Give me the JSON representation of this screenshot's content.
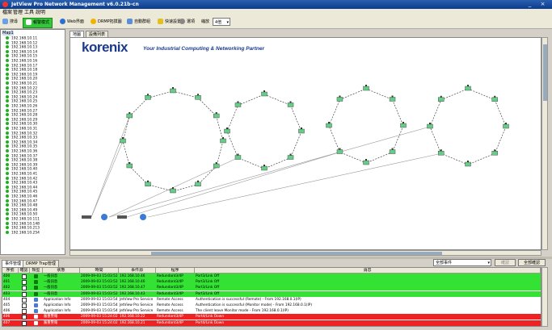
{
  "window": {
    "title": "JetView Pro Network Management v6.0.21b-cn",
    "controls": [
      "_",
      "×"
    ]
  },
  "menu": [
    "檔案",
    "管理",
    "工具",
    "說明"
  ],
  "toolbar": {
    "buttons": [
      "搜尋",
      "報警模式",
      "Web界面",
      "DRMP拓撲圖",
      "自動群組",
      "快速設置",
      "選項"
    ],
    "zoom_label": "縮放",
    "zoom_value": "4倍"
  },
  "tree": {
    "root": "Map1",
    "items": [
      "192.168.10.11",
      "192.168.10.12",
      "192.168.10.13",
      "192.168.10.14",
      "192.168.10.15",
      "192.168.10.16",
      "192.168.10.17",
      "192.168.10.18",
      "192.168.10.19",
      "192.168.10.20",
      "192.168.10.21",
      "192.168.10.22",
      "192.168.10.23",
      "192.168.10.24",
      "192.168.10.25",
      "192.168.10.26",
      "192.168.10.27",
      "192.168.10.28",
      "192.168.10.29",
      "192.168.10.30",
      "192.168.10.31",
      "192.168.10.32",
      "192.168.10.33",
      "192.168.10.34",
      "192.168.10.35",
      "192.168.10.36",
      "192.168.10.37",
      "192.168.10.38",
      "192.168.10.39",
      "192.168.10.40",
      "192.168.10.41",
      "192.168.10.42",
      "192.168.10.43",
      "192.168.10.44",
      "192.168.10.45",
      "192.168.10.46",
      "192.168.10.47",
      "192.168.10.48",
      "192.168.10.49",
      "192.168.10.50",
      "192.168.10.111",
      "192.168.10.148",
      "192.168.10.213",
      "192.168.10.254"
    ]
  },
  "map_tabs": [
    "地圖",
    "設備列表"
  ],
  "canvas": {
    "brand": "korenix",
    "tagline": "Your Industrial Computing & Networking Partner",
    "accent": "#1b3a8c"
  },
  "bottom_tabs": [
    "事件管理",
    "DRMP Trap管理"
  ],
  "filter": {
    "value": "全部事件",
    "buttons": [
      "確認",
      "全部確認"
    ]
  },
  "event_table": {
    "columns": [
      "序號",
      "確認",
      "類型",
      "狀態",
      "時間",
      "事件源",
      "程序",
      "消息"
    ],
    "rows": [
      {
        "color": "#33e233",
        "id": "400",
        "type": "一般訊息",
        "time": "2009-09-03 15:03:52",
        "source": "192.168.10.46",
        "program": "Redundant3/4P",
        "message": "Port3/Link Off"
      },
      {
        "color": "#33e233",
        "id": "401",
        "type": "一般訊息",
        "time": "2009-09-03 15:03:52",
        "source": "192.168.10.46",
        "program": "Redundant3/4P",
        "message": "Port3/Link Off"
      },
      {
        "color": "#33e233",
        "id": "402",
        "type": "一般訊息",
        "time": "2009-09-03 15:03:52",
        "source": "192.168.10.47",
        "program": "Redundant3/4P",
        "message": "Port3/Link Off"
      },
      {
        "color": "#33e233",
        "id": "403",
        "type": "一般訊息",
        "time": "2009-09-03 15:03:52",
        "source": "192.168.10.43",
        "program": "Redundant3/4P",
        "message": "Port3/Link Off"
      },
      {
        "color": "#ffffff",
        "id": "404",
        "type": "Application Info",
        "time": "2009-09-03 15:03:54",
        "source": "JetView Pro Service",
        "program": "Remote Access",
        "message": "Authentication is successful (Remote) - From 192.168.0.1(IP)"
      },
      {
        "color": "#ffffff",
        "id": "405",
        "type": "Application Info",
        "time": "2009-09-03 15:03:54",
        "source": "JetView Pro Service",
        "program": "Remote Access",
        "message": "Authentication is successful (Monitor mode) - From 192.168.0.1(IP)"
      },
      {
        "color": "#ffffff",
        "id": "406",
        "type": "Application Info",
        "time": "2009-09-03 15:03:54",
        "source": "JetView Pro Service",
        "program": "Remote Access",
        "message": "The client leave Monitor mode - From 192.168.0.1(IP)"
      },
      {
        "color": "#ee2222",
        "id": "406",
        "type": "嚴重警報",
        "time": "2009-09-03 15:24:02",
        "source": "192.168.10.22",
        "program": "Redundant3/4P",
        "message": "Port4/Link Down"
      },
      {
        "color": "#ee2222",
        "id": "407",
        "type": "嚴重警報",
        "time": "2009-09-03 15:24:02",
        "source": "192.168.10.21",
        "program": "Redundant3/4P",
        "message": "Port4/Link Down"
      }
    ]
  }
}
